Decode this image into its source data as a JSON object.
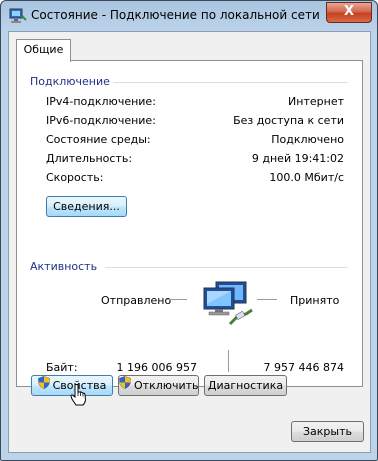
{
  "window": {
    "title": "Состояние - Подключение по локальной сети",
    "close_label": "X"
  },
  "tabs": [
    {
      "label": "Общие"
    }
  ],
  "connection": {
    "heading": "Подключение",
    "rows": [
      {
        "label": "IPv4-подключение:",
        "value": "Интернет"
      },
      {
        "label": "IPv6-подключение:",
        "value": "Без доступа к сети"
      },
      {
        "label": "Состояние среды:",
        "value": "Подключено"
      },
      {
        "label": "Длительность:",
        "value": "9 дней 19:41:02"
      },
      {
        "label": "Скорость:",
        "value": "100.0 Мбит/с"
      }
    ],
    "details_button": "Сведения..."
  },
  "activity": {
    "heading": "Активность",
    "sent_label": "Отправлено",
    "received_label": "Принято",
    "bytes_label": "Байт:",
    "bytes_sent": "1 196 006 957",
    "bytes_received": "7 957 446 874"
  },
  "buttons": {
    "properties": "Свойства",
    "disable": "Отключить",
    "diagnose": "Диагностика",
    "close": "Закрыть"
  },
  "icons": {
    "app": "network-icon",
    "shield": "uac-shield-icon",
    "activity": "network-computers-icon",
    "cursor": "hand-pointer-icon"
  },
  "colors": {
    "group_heading": "#1e3287",
    "close_button": "#c3421f",
    "title_bar": "#bcd3ea"
  }
}
